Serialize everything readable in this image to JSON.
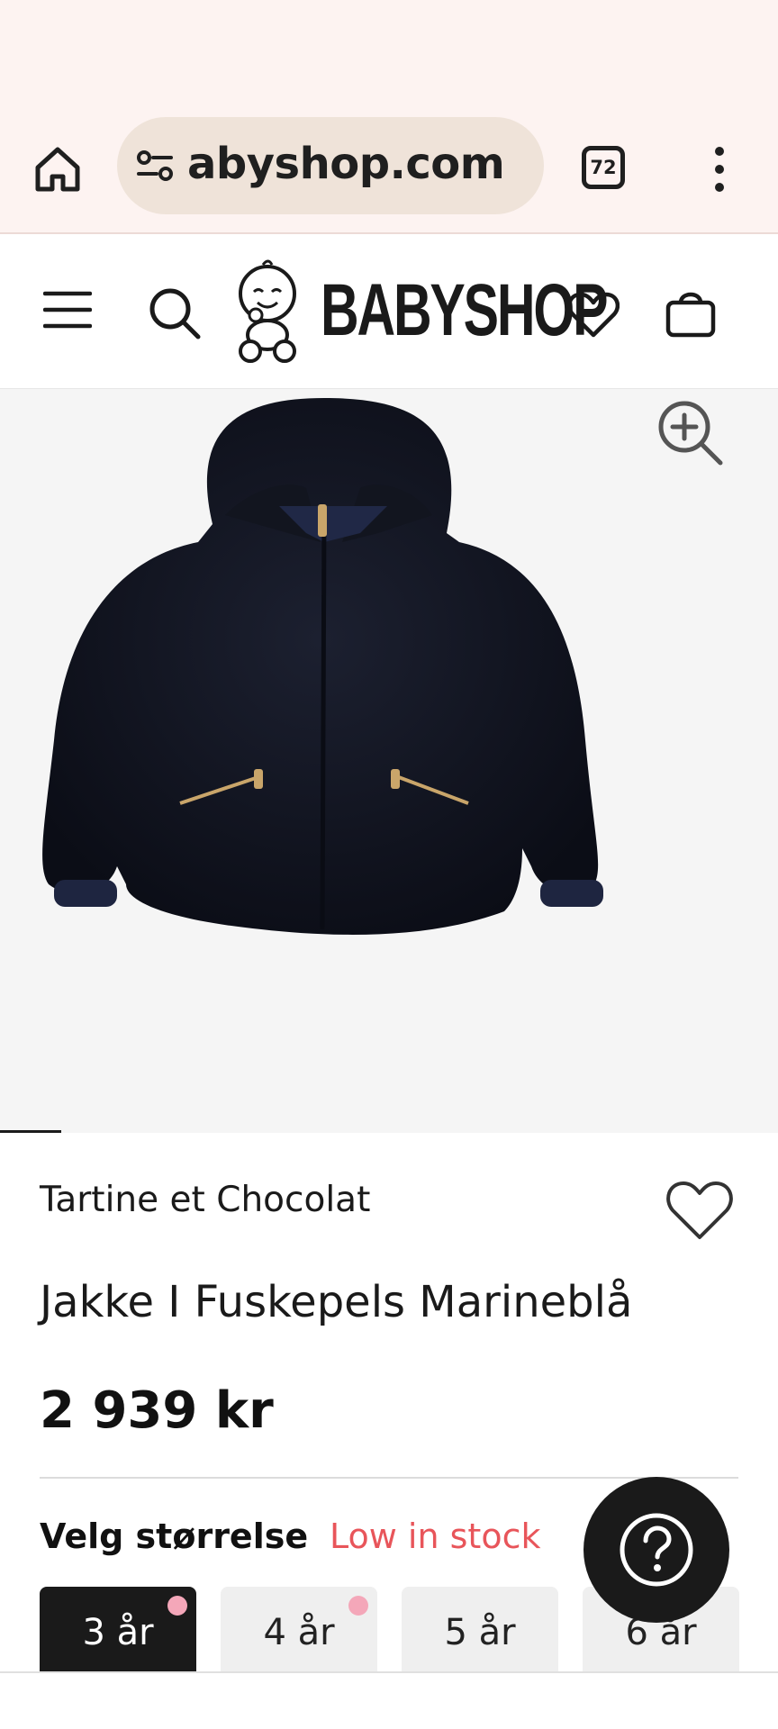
{
  "browser": {
    "url_display": "abyshop.com",
    "tab_count": "72",
    "icons": [
      "home-icon",
      "tune-icon",
      "tabs-icon",
      "more-vert-icon"
    ]
  },
  "site_header": {
    "logo_text": "BABYSHOP",
    "icons": [
      "menu-icon",
      "search-icon",
      "baby-logo-icon",
      "heart-icon",
      "bag-icon"
    ]
  },
  "product": {
    "image_description_icon": "zoom-in-icon",
    "brand": "Tartine et Chocolat",
    "title": "Jakke I Fuskepels Marineblå",
    "price": "2 939 kr",
    "size_label": "Velg størrelse",
    "stock_status": "Low in stock",
    "sizes": [
      {
        "label": "3 år",
        "selected": true,
        "low_stock": true
      },
      {
        "label": "4 år",
        "selected": false,
        "low_stock": true
      },
      {
        "label": "5 år",
        "selected": false,
        "low_stock": false
      },
      {
        "label": "6 år",
        "selected": false,
        "low_stock": false
      }
    ]
  },
  "help": {
    "icon": "help-question-icon"
  },
  "colors": {
    "browser_bg": "#fdf3f1",
    "url_pill": "#efe3d9",
    "stock_red": "#e8555a",
    "low_stock_dot": "#f4a7b9",
    "dark": "#1a1a1a"
  }
}
